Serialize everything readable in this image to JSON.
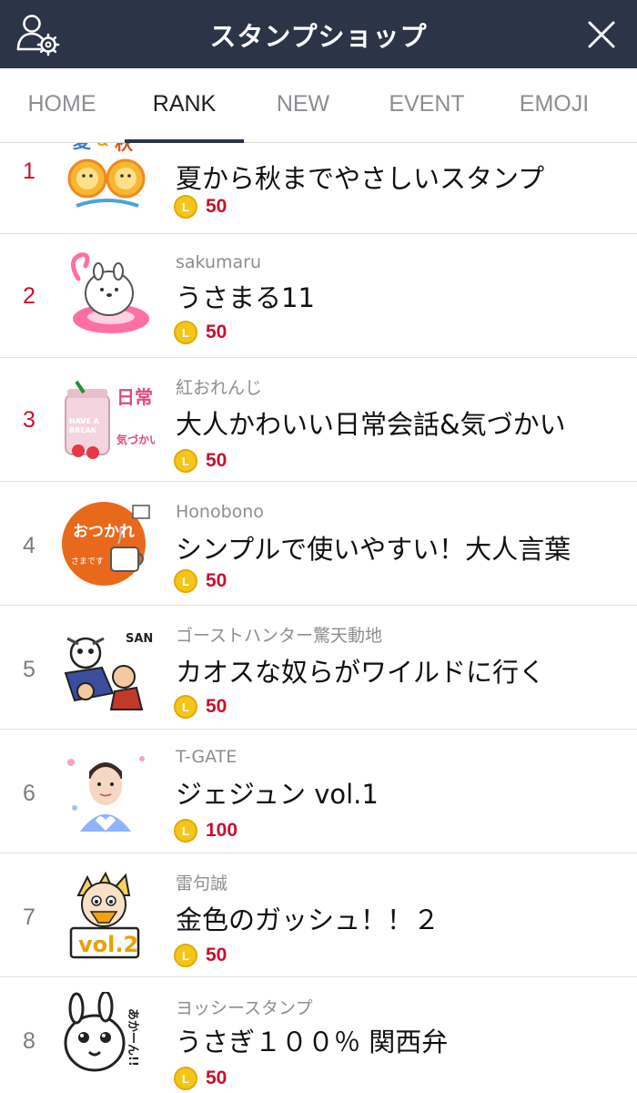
{
  "header": {
    "title": "スタンプショップ",
    "settings_icon": "user-settings-icon",
    "close_icon": "close-icon",
    "bg_color": "#2c3447"
  },
  "tabs": [
    {
      "label": "HOME",
      "active": false
    },
    {
      "label": "RANK",
      "active": true
    },
    {
      "label": "NEW",
      "active": false
    },
    {
      "label": "EVENT",
      "active": false
    },
    {
      "label": "EMOJI",
      "active": false
    }
  ],
  "colors": {
    "rank_highlight": "#c8102e",
    "rank_normal": "#7d7d7d",
    "price": "#c8102e",
    "coin": "#f5c518"
  },
  "coin_symbol": "L",
  "items": [
    {
      "rank": "1",
      "author": "",
      "name": "夏から秋までやさしいスタンプ",
      "price": "50",
      "thumb": "summer-autumn-lion-sticker"
    },
    {
      "rank": "2",
      "author": "sakumaru",
      "name": "うさまる11",
      "price": "50",
      "thumb": "rabbit-flamingo-float-sticker"
    },
    {
      "rank": "3",
      "author": "紅おれんじ",
      "name": "大人かわいい日常会話&気づかい",
      "price": "50",
      "thumb": "strawberry-jar-sticker",
      "thumb_text": "日常",
      "thumb_text2": "気づかい"
    },
    {
      "rank": "4",
      "author": "Honobono",
      "name": "シンプルで使いやすい！大人言葉",
      "price": "50",
      "thumb": "otsukare-cup-sticker",
      "thumb_text": "おつかれ",
      "thumb_text2": "さまです"
    },
    {
      "rank": "5",
      "author": "ゴーストハンター驚天動地",
      "name": "カオスな奴らがワイルドに行く",
      "price": "50",
      "thumb": "chaos-characters-sticker"
    },
    {
      "rank": "6",
      "author": "T-GATE",
      "name": "ジェジュン vol.1",
      "price": "100",
      "thumb": "idol-heart-sticker"
    },
    {
      "rank": "7",
      "author": "雷句誠",
      "name": "金色のガッシュ！！２",
      "price": "50",
      "thumb": "gash-vol2-sticker",
      "thumb_text": "vol.2"
    },
    {
      "rank": "8",
      "author": "ヨッシースタンプ",
      "name": "うさぎ１００％ 関西弁",
      "price": "50",
      "thumb": "rabbit-kansai-sticker",
      "thumb_text": "あかーん!!"
    }
  ]
}
